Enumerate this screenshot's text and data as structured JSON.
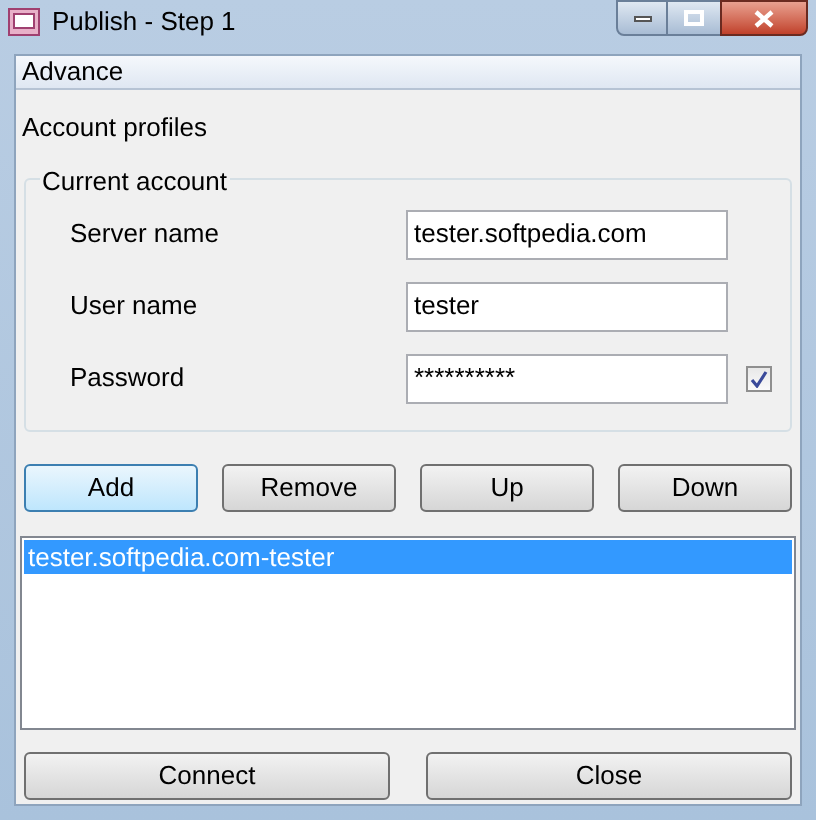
{
  "window": {
    "title": "Publish - Step 1"
  },
  "menu": [
    "Advance"
  ],
  "section_label": "Account profiles",
  "group": {
    "title": "Current account",
    "fields": [
      {
        "label": "Server name",
        "value": "tester.softpedia.com"
      },
      {
        "label": "User name",
        "value": "tester"
      },
      {
        "label": "Password",
        "value": "**********",
        "checkbox": {
          "checked": true
        }
      }
    ]
  },
  "buttons": [
    {
      "label": "Add",
      "focused": true
    },
    {
      "label": "Remove",
      "focused": false
    },
    {
      "label": "Up",
      "focused": false
    },
    {
      "label": "Down",
      "focused": false
    }
  ],
  "list": [
    {
      "label": "tester.softpedia.com-tester",
      "selected": true
    }
  ],
  "footer_buttons": [
    "Connect",
    "Close"
  ]
}
